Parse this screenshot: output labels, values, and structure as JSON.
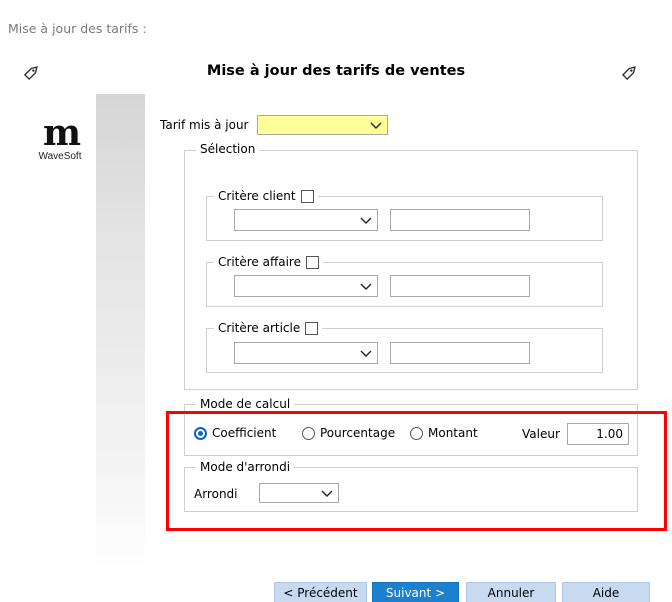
{
  "breadcrumb": "Mise à jour des tarifs :",
  "title": "Mise à jour des tarifs de ventes",
  "logo": {
    "text": "WaveSoft",
    "mark": "m"
  },
  "tarif": {
    "label": "Tarif mis à jour",
    "value": "",
    "highlight_color": "#ffff99"
  },
  "selection": {
    "title": "Sélection",
    "client": {
      "label": "Critère client",
      "checked": false,
      "select_value": "",
      "text_value": ""
    },
    "affaire": {
      "label": "Critère affaire",
      "checked": false,
      "select_value": "",
      "text_value": ""
    },
    "article": {
      "label": "Critère article",
      "checked": false,
      "select_value": "",
      "text_value": ""
    }
  },
  "mode_calcul": {
    "title": "Mode de calcul",
    "options": [
      "Coefficient",
      "Pourcentage",
      "Montant"
    ],
    "selected": "Coefficient",
    "valeur_label": "Valeur",
    "valeur": "1.00"
  },
  "mode_arrondi": {
    "title": "Mode d'arrondi",
    "arrondi_label": "Arrondi",
    "arrondi_value": ""
  },
  "buttons": {
    "prev": "< Précédent",
    "next": "Suivant >",
    "cancel": "Annuler",
    "help": "Aide"
  },
  "colors": {
    "accent": "#1b80d0",
    "radio_selected": "#0a62c9",
    "highlight_frame": "#ff0000"
  },
  "icons": [
    "tag-icon",
    "chevron-down-icon"
  ]
}
